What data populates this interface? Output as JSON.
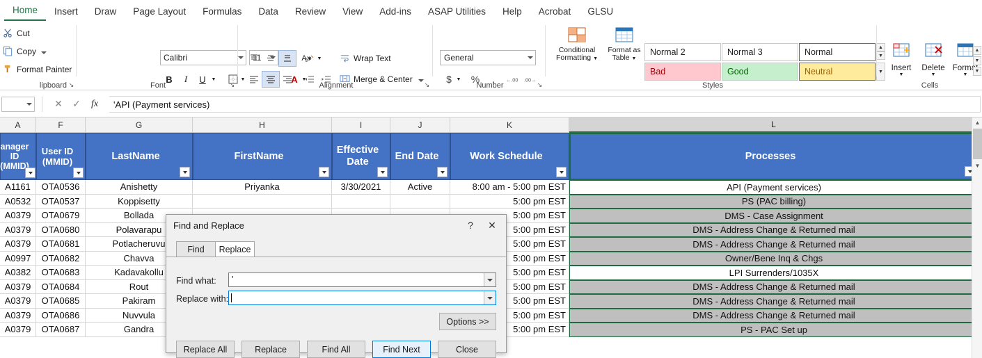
{
  "ribbon": {
    "tabs": [
      {
        "label": "Home",
        "active": true
      },
      {
        "label": "Insert",
        "active": false
      },
      {
        "label": "Draw",
        "active": false
      },
      {
        "label": "Page Layout",
        "active": false
      },
      {
        "label": "Formulas",
        "active": false
      },
      {
        "label": "Data",
        "active": false
      },
      {
        "label": "Review",
        "active": false
      },
      {
        "label": "View",
        "active": false
      },
      {
        "label": "Add-ins",
        "active": false
      },
      {
        "label": "ASAP Utilities",
        "active": false
      },
      {
        "label": "Help",
        "active": false
      },
      {
        "label": "Acrobat",
        "active": false
      },
      {
        "label": "GLSU",
        "active": false
      }
    ],
    "groups": {
      "clipboard": {
        "label": "lipboard",
        "cut": "Cut",
        "copy": "Copy",
        "format_painter": "Format Painter"
      },
      "font": {
        "label": "Font",
        "font_name": "Calibri",
        "font_size": "11",
        "grow": "A",
        "shrink": "A",
        "bold": "B",
        "italic": "I",
        "underline": "U",
        "borders": "borders",
        "fill_color": "fill-color",
        "font_color": "A"
      },
      "alignment": {
        "label": "Alignment",
        "wrap_text": "Wrap Text",
        "merge_center": "Merge & Center"
      },
      "number": {
        "label": "Number",
        "format": "General",
        "currency": "$",
        "percent": "%",
        "comma": ",",
        "increase_decimal": ".00",
        "decrease_decimal": ".00"
      },
      "styles": {
        "label": "Styles",
        "conditional_formatting": "Conditional Formatting",
        "format_as_table": "Format as Table",
        "cells": [
          {
            "label": "Normal 2",
            "bg": "#ffffff",
            "fg": "#222222",
            "selected": false
          },
          {
            "label": "Normal 3",
            "bg": "#ffffff",
            "fg": "#222222",
            "selected": false
          },
          {
            "label": "Normal",
            "bg": "#ffffff",
            "fg": "#222222",
            "selected": true
          },
          {
            "label": "Bad",
            "bg": "#ffc7ce",
            "fg": "#9c0006",
            "selected": false
          },
          {
            "label": "Good",
            "bg": "#c6efce",
            "fg": "#006100",
            "selected": false
          },
          {
            "label": "Neutral",
            "bg": "#ffeb9c",
            "fg": "#9c6500",
            "selected": true
          }
        ]
      },
      "cells": {
        "label": "Cells",
        "insert": "Insert",
        "delete": "Delete",
        "format": "Format"
      }
    }
  },
  "formula_bar": {
    "name_box": "",
    "cancel": "✕",
    "enter": "✓",
    "function": "fx",
    "value": "'API (Payment services)"
  },
  "sheet": {
    "columns": [
      {
        "letter": "A",
        "highlighted": false
      },
      {
        "letter": "F",
        "highlighted": false
      },
      {
        "letter": "G",
        "highlighted": false
      },
      {
        "letter": "H",
        "highlighted": false
      },
      {
        "letter": "I",
        "highlighted": false
      },
      {
        "letter": "J",
        "highlighted": false
      },
      {
        "letter": "K",
        "highlighted": false
      },
      {
        "letter": "L",
        "highlighted": true
      }
    ],
    "headers": [
      "anager ID (MMID)",
      "User ID (MMID)",
      "LastName",
      "FirstName",
      "Effective Date",
      "End Date",
      "Work Schedule",
      "Processes"
    ],
    "header_colors": {
      "bg": "#4472c4",
      "fg": "#ffffff",
      "border": "#2f528f"
    },
    "rows": [
      {
        "a": "A1161",
        "f": "OTA0536",
        "g": "Anishetty",
        "h": "Priyanka",
        "i": "3/30/2021",
        "j": "Active",
        "k": "8:00 am - 5:00 pm EST",
        "l": "API (Payment services)",
        "shaded": false
      },
      {
        "a": "A0532",
        "f": "OTA0537",
        "g": "Koppisetty",
        "h": "",
        "i": "",
        "j": "",
        "k": "5:00 pm EST",
        "l": "PS (PAC billing)",
        "shaded": true
      },
      {
        "a": "A0379",
        "f": "OTA0679",
        "g": "Bollada",
        "h": "",
        "i": "",
        "j": "",
        "k": "5:00 pm EST",
        "l": "DMS - Case Assignment",
        "shaded": true
      },
      {
        "a": "A0379",
        "f": "OTA0680",
        "g": "Polavarapu",
        "h": "",
        "i": "",
        "j": "",
        "k": "5:00 pm EST",
        "l": "DMS - Address Change & Returned mail",
        "shaded": true
      },
      {
        "a": "A0379",
        "f": "OTA0681",
        "g": "Potlacheruvu",
        "h": "",
        "i": "",
        "j": "",
        "k": "5:00 pm EST",
        "l": "DMS - Address Change & Returned mail",
        "shaded": true
      },
      {
        "a": "A0997",
        "f": "OTA0682",
        "g": "Chavva",
        "h": "",
        "i": "",
        "j": "",
        "k": "5:00 pm EST",
        "l": "Owner/Bene Inq & Chgs",
        "shaded": true
      },
      {
        "a": "A0382",
        "f": "OTA0683",
        "g": "Kadavakollu",
        "h": "",
        "i": "",
        "j": "",
        "k": "5:00 pm EST",
        "l": "LPI Surrenders/1035X",
        "shaded": false
      },
      {
        "a": "A0379",
        "f": "OTA0684",
        "g": "Rout",
        "h": "",
        "i": "",
        "j": "",
        "k": "5:00 pm EST",
        "l": "DMS - Address Change & Returned mail",
        "shaded": true
      },
      {
        "a": "A0379",
        "f": "OTA0685",
        "g": "Pakiram",
        "h": "",
        "i": "",
        "j": "",
        "k": "5:00 pm EST",
        "l": "DMS - Address Change & Returned mail",
        "shaded": true
      },
      {
        "a": "A0379",
        "f": "OTA0686",
        "g": "Nuvvula",
        "h": "",
        "i": "",
        "j": "",
        "k": "5:00 pm EST",
        "l": "DMS - Address Change & Returned mail",
        "shaded": true
      },
      {
        "a": "A0379",
        "f": "OTA0687",
        "g": "Gandra",
        "h": "",
        "i": "",
        "j": "",
        "k": "5:00 pm EST",
        "l": "PS - PAC Set up",
        "shaded": true
      }
    ]
  },
  "dialog": {
    "title": "Find and Replace",
    "help": "?",
    "close": "✕",
    "tabs": [
      {
        "label": "Find",
        "active": false
      },
      {
        "label": "Replace",
        "active": true
      }
    ],
    "find_label": "Find what:",
    "find_value": "'",
    "replace_label": "Replace with:",
    "replace_value": "",
    "options_button": "Options >>",
    "buttons": [
      {
        "label": "Replace All",
        "default": false
      },
      {
        "label": "Replace",
        "default": false
      },
      {
        "label": "Find All",
        "default": false
      },
      {
        "label": "Find Next",
        "default": true
      },
      {
        "label": "Close",
        "default": false
      }
    ]
  }
}
